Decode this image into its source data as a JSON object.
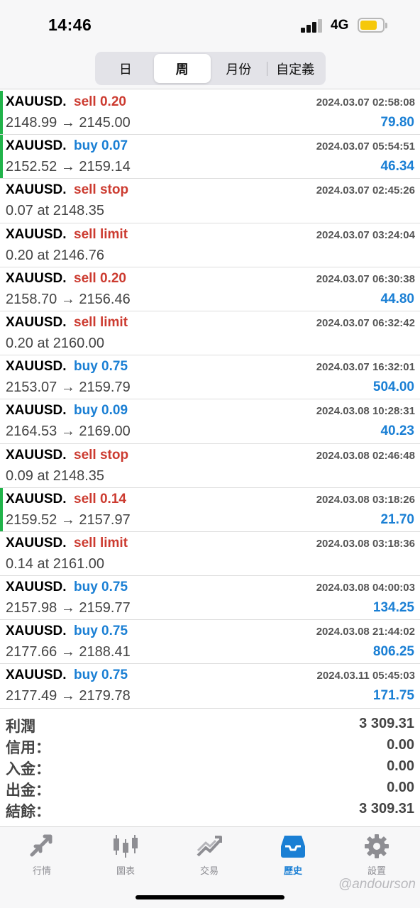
{
  "status": {
    "time": "14:46",
    "network": "4G"
  },
  "periods": {
    "tabs": [
      "日",
      "周",
      "月份",
      "自定義"
    ],
    "active_index": 1
  },
  "trades": [
    {
      "symbol": "XAUUSD.",
      "type": "sell 0.20",
      "side": "sell",
      "time": "2024.03.07 02:58:08",
      "detail": "2148.99 → 2145.00",
      "profit": "79.80",
      "marked": true
    },
    {
      "symbol": "XAUUSD.",
      "type": "buy 0.07",
      "side": "buy",
      "time": "2024.03.07 05:54:51",
      "detail": "2152.52 → 2159.14",
      "profit": "46.34",
      "marked": true
    },
    {
      "symbol": "XAUUSD.",
      "type": "sell stop",
      "side": "sell",
      "time": "2024.03.07 02:45:26",
      "detail": "0.07 at 2148.35",
      "profit": "",
      "marked": false
    },
    {
      "symbol": "XAUUSD.",
      "type": "sell limit",
      "side": "sell",
      "time": "2024.03.07 03:24:04",
      "detail": "0.20 at 2146.76",
      "profit": "",
      "marked": false
    },
    {
      "symbol": "XAUUSD.",
      "type": "sell 0.20",
      "side": "sell",
      "time": "2024.03.07 06:30:38",
      "detail": "2158.70 → 2156.46",
      "profit": "44.80",
      "marked": false
    },
    {
      "symbol": "XAUUSD.",
      "type": "sell limit",
      "side": "sell",
      "time": "2024.03.07 06:32:42",
      "detail": "0.20 at 2160.00",
      "profit": "",
      "marked": false
    },
    {
      "symbol": "XAUUSD.",
      "type": "buy 0.75",
      "side": "buy",
      "time": "2024.03.07 16:32:01",
      "detail": "2153.07 → 2159.79",
      "profit": "504.00",
      "marked": false
    },
    {
      "symbol": "XAUUSD.",
      "type": "buy 0.09",
      "side": "buy",
      "time": "2024.03.08 10:28:31",
      "detail": "2164.53 → 2169.00",
      "profit": "40.23",
      "marked": false
    },
    {
      "symbol": "XAUUSD.",
      "type": "sell stop",
      "side": "sell",
      "time": "2024.03.08 02:46:48",
      "detail": "0.09 at 2148.35",
      "profit": "",
      "marked": false
    },
    {
      "symbol": "XAUUSD.",
      "type": "sell 0.14",
      "side": "sell",
      "time": "2024.03.08 03:18:26",
      "detail": "2159.52 → 2157.97",
      "profit": "21.70",
      "marked": true
    },
    {
      "symbol": "XAUUSD.",
      "type": "sell limit",
      "side": "sell",
      "time": "2024.03.08 03:18:36",
      "detail": "0.14 at 2161.00",
      "profit": "",
      "marked": false
    },
    {
      "symbol": "XAUUSD.",
      "type": "buy 0.75",
      "side": "buy",
      "time": "2024.03.08 04:00:03",
      "detail": "2157.98 → 2159.77",
      "profit": "134.25",
      "marked": false
    },
    {
      "symbol": "XAUUSD.",
      "type": "buy 0.75",
      "side": "buy",
      "time": "2024.03.08 21:44:02",
      "detail": "2177.66 → 2188.41",
      "profit": "806.25",
      "marked": false
    },
    {
      "symbol": "XAUUSD.",
      "type": "buy 0.75",
      "side": "buy",
      "time": "2024.03.11 05:45:03",
      "detail": "2177.49 → 2179.78",
      "profit": "171.75",
      "marked": false
    }
  ],
  "summary": [
    {
      "label": "利潤",
      "value": "3 309.31"
    },
    {
      "label": "信用：",
      "value": "0.00"
    },
    {
      "label": "入金：",
      "value": "0.00"
    },
    {
      "label": "出金：",
      "value": "0.00"
    },
    {
      "label": "結餘：",
      "value": "3 309.31"
    }
  ],
  "tabbar": [
    {
      "label": "行情",
      "icon": "quotes-arrows-icon"
    },
    {
      "label": "圖表",
      "icon": "candlestick-chart-icon"
    },
    {
      "label": "交易",
      "icon": "trade-trend-icon"
    },
    {
      "label": "歷史",
      "icon": "history-inbox-icon"
    },
    {
      "label": "設置",
      "icon": "gear-icon"
    }
  ],
  "active_tab_index": 3,
  "watermark": "@andourson",
  "colors": {
    "sell": "#cc3b30",
    "buy": "#1a7fd4",
    "marker": "#21b34a",
    "battery": "#f6c80a"
  }
}
